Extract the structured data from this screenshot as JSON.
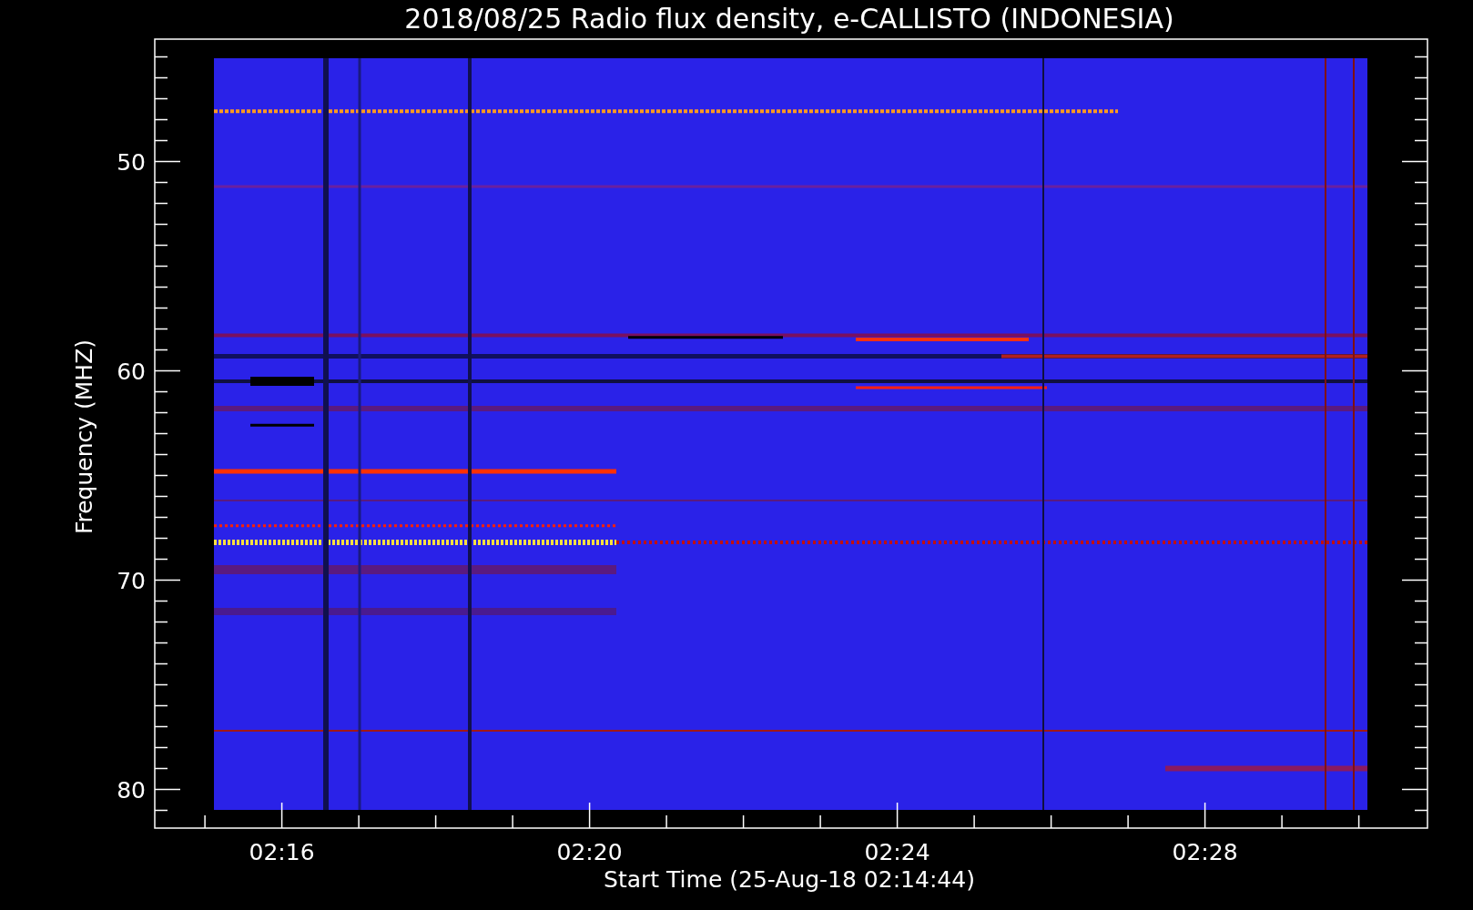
{
  "title": "2018/08/25  Radio flux density, e-CALLISTO (INDONESIA)",
  "y_axis": {
    "label": "Frequency (MHZ)",
    "ticks": [
      "50",
      "60",
      "70",
      "80"
    ]
  },
  "x_axis": {
    "label": "Start Time (25-Aug-18 02:14:44)",
    "ticks": [
      "02:16",
      "02:20",
      "02:24",
      "02:28"
    ]
  }
}
